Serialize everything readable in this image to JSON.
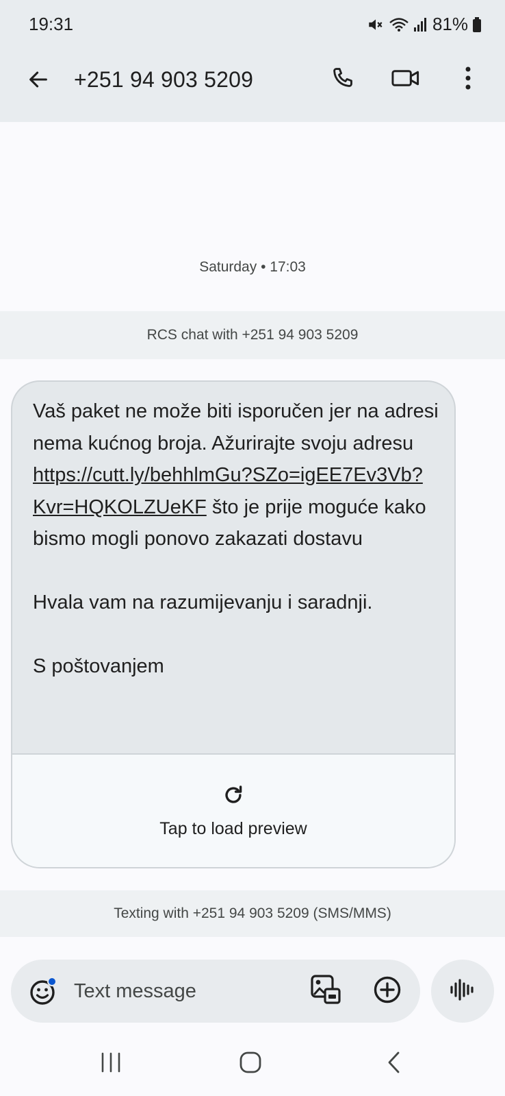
{
  "status_bar": {
    "time": "19:31",
    "battery": "81%",
    "icons": [
      "mute-icon",
      "wifi-icon",
      "signal-icon",
      "battery-icon"
    ]
  },
  "app_bar": {
    "title": "+251 94 903 5209",
    "back_icon": "arrow-back-icon",
    "actions": [
      "phone-icon",
      "video-camera-icon",
      "more-vert-icon"
    ]
  },
  "conversation": {
    "date_label": "Saturday • 17:03",
    "rcs_banner": "RCS chat with +251 94 903 5209",
    "message": {
      "text_before_link": "Vaš paket ne može biti isporučen jer na adresi nema kućnog broja. Ažurirajte svoju adresu ",
      "link": "https://cutt.ly/behhlmGu?SZo=igEE7Ev3Vb?Kvr=HQKOLZUeKF",
      "text_after_link": " što je prije moguće kako bismo mogli ponovo zakazati dostavu\n\nHvala vam na razumijevanju i saradnji.\n\nS poštovanjem",
      "preview_label": "Tap to load preview",
      "preview_icon": "refresh-icon"
    },
    "sms_banner": "Texting with +251 94 903 5209 (SMS/MMS)"
  },
  "composer": {
    "placeholder": "Text message",
    "icons": [
      "emoji-icon",
      "gallery-icon",
      "add-circle-icon",
      "voice-icon"
    ]
  },
  "nav_bar": {
    "buttons": [
      "recents-icon",
      "home-icon",
      "back-icon"
    ]
  },
  "colors": {
    "header_bg": "#e8ecef",
    "bubble_bg": "#e4e8eb",
    "page_bg": "#fafafd",
    "accent_dot": "#0b57d0"
  }
}
